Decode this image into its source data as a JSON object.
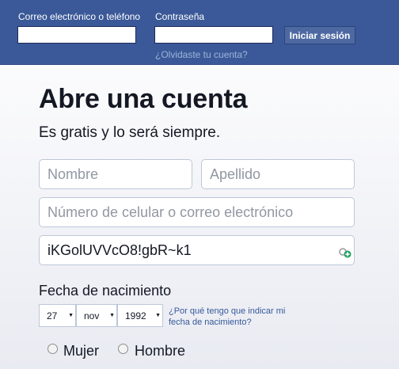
{
  "header": {
    "email_label": "Correo electrónico o teléfono",
    "email_value": "",
    "password_label": "Contraseña",
    "password_value": "",
    "login_button": "Iniciar sesión",
    "forgot_link": "¿Olvidaste tu cuenta?"
  },
  "signup": {
    "title": "Abre una cuenta",
    "subtitle": "Es gratis y lo será siempre.",
    "first_name_placeholder": "Nombre",
    "last_name_placeholder": "Apellido",
    "contact_placeholder": "Número de celular o correo electrónico",
    "password_value": "iKGolUVVcO8!gbR~k1",
    "dob_label": "Fecha de nacimiento",
    "dob_day": "27",
    "dob_month": "nov",
    "dob_year": "1992",
    "why_link_line1": "¿Por qué tengo que indicar mi",
    "why_link_line2": "fecha de nacimiento?",
    "gender_female": "Mujer",
    "gender_male": "Hombre"
  },
  "colors": {
    "brand": "#3b5998",
    "button": "#4e69a2",
    "link": "#365899"
  },
  "icons": [
    "password-manager-key-icon"
  ]
}
